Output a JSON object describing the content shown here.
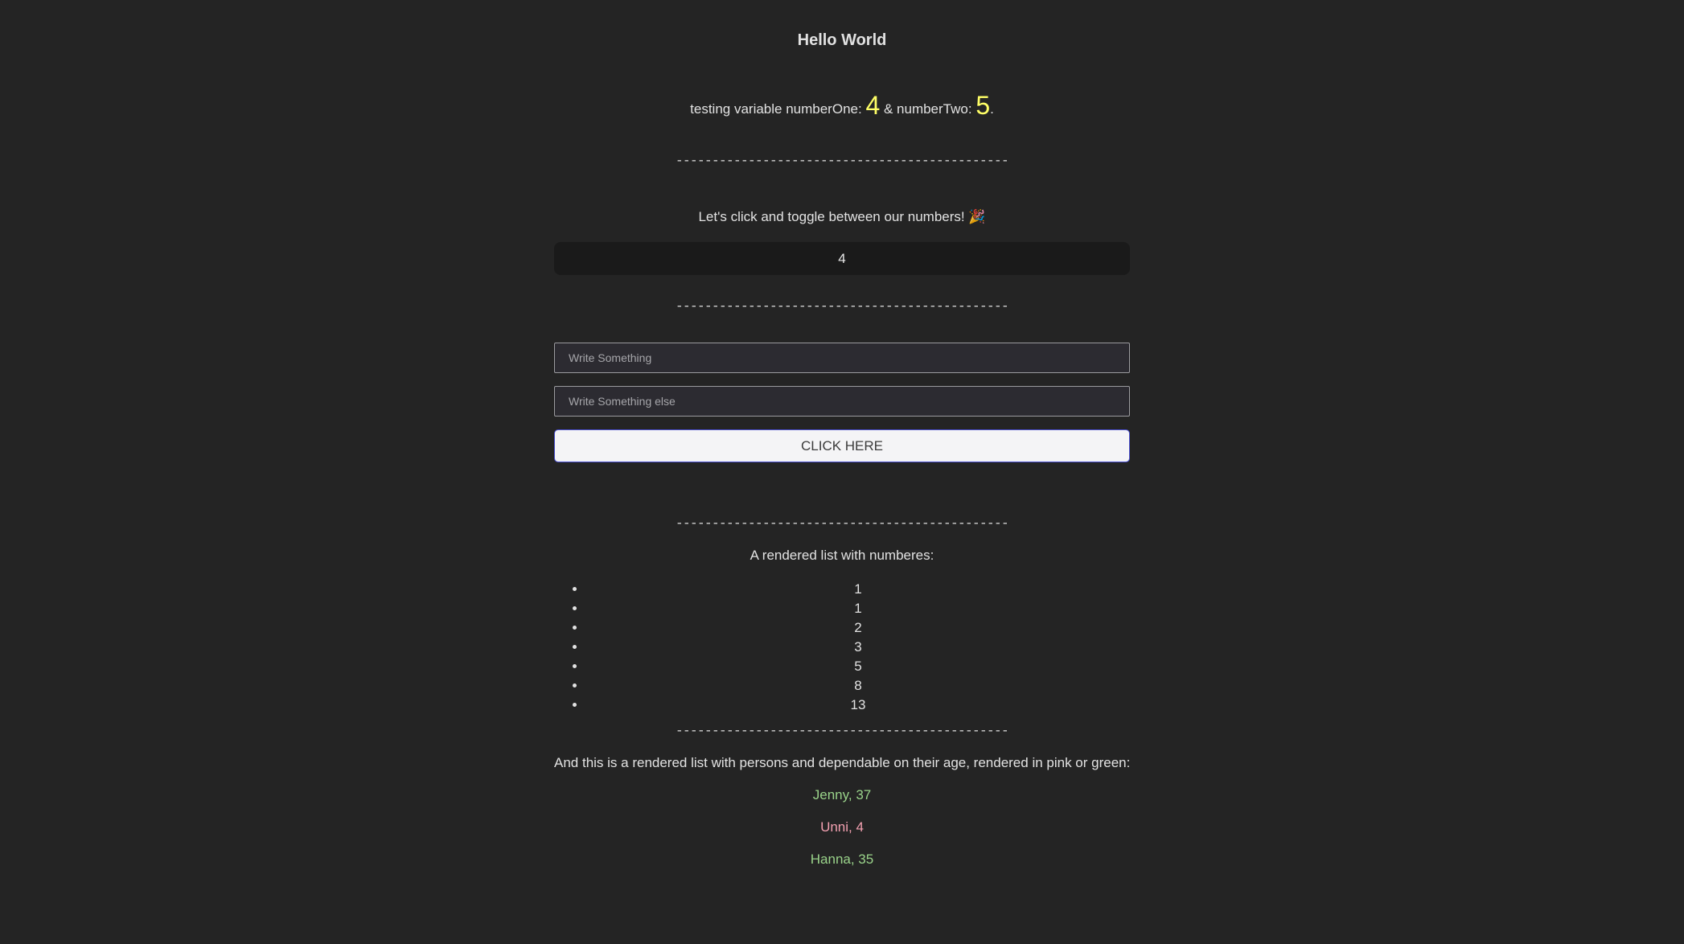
{
  "header": {
    "title": "Hello World"
  },
  "variables": {
    "prefix": "testing variable numberOne:",
    "number_one": "4",
    "middle": "& numberTwo:",
    "number_two": "5",
    "suffix": "."
  },
  "divider_text": "----------------------------------------------",
  "toggle": {
    "text": "Let's click and toggle between our numbers! 🎉",
    "button_label": "4"
  },
  "form": {
    "input_one_value": "",
    "input_one_placeholder": "Write Something",
    "input_two_value": "",
    "input_two_placeholder": "Write Something else",
    "submit_label": "CLICK HERE"
  },
  "number_list": {
    "title": "A rendered list with numberes:",
    "items": [
      "1",
      "1",
      "2",
      "3",
      "5",
      "8",
      "13"
    ]
  },
  "persons": {
    "title": "And this is a rendered list with persons and dependable on their age, rendered in pink or green:",
    "items": [
      {
        "text": "Jenny, 37",
        "color": "green"
      },
      {
        "text": "Unni, 4",
        "color": "pink"
      },
      {
        "text": "Hanna, 35",
        "color": "green"
      }
    ]
  },
  "colors": {
    "background": "#242424",
    "highlight_number": "#ffff66",
    "green": "#9ad38a",
    "pink": "#f2a0b0"
  }
}
